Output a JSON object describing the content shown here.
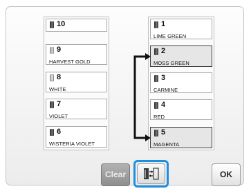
{
  "left_list": [
    {
      "number": "10",
      "name": ""
    },
    {
      "number": "9",
      "name": "HARVEST GOLD"
    },
    {
      "number": "8",
      "name": "WHITE"
    },
    {
      "number": "7",
      "name": "VIOLET"
    },
    {
      "number": "6",
      "name": "WISTERIA VIOLET"
    }
  ],
  "right_list": [
    {
      "number": "1",
      "name": "LIME GREEN"
    },
    {
      "number": "2",
      "name": "MOSS GREEN"
    },
    {
      "number": "3",
      "name": "CARMINE"
    },
    {
      "number": "4",
      "name": "RED"
    },
    {
      "number": "5",
      "name": "MAGENTA"
    }
  ],
  "buttons": {
    "clear_label": "Clear",
    "swap_icon": "swap-spools-icon",
    "ok_label": "OK"
  },
  "colors": {
    "selection_ring": "#1b8fe0",
    "clear_disabled": "#9e9e9e"
  }
}
